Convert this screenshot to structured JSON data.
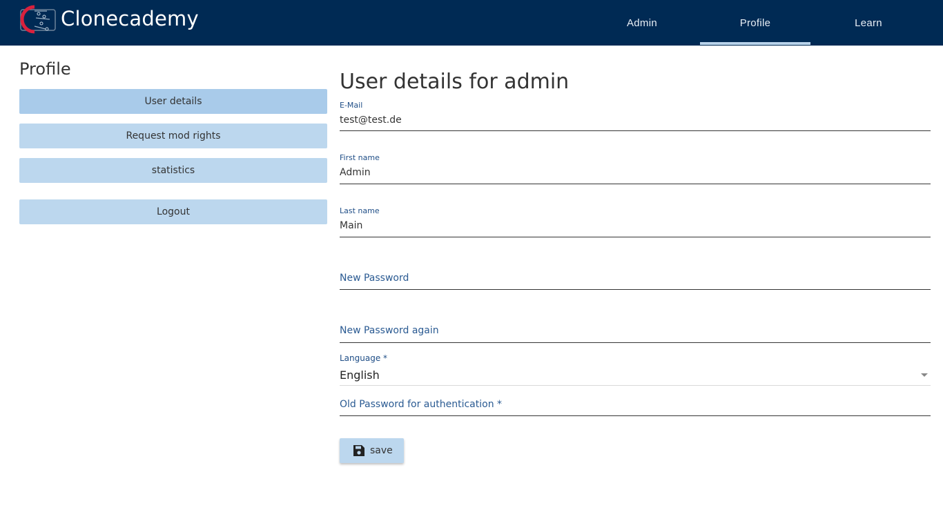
{
  "header": {
    "brand": "Clonecademy",
    "nav": [
      {
        "label": "Admin",
        "active": false
      },
      {
        "label": "Profile",
        "active": true
      },
      {
        "label": "Learn",
        "active": false
      }
    ]
  },
  "sidebar": {
    "title": "Profile",
    "items": [
      {
        "label": "User details",
        "active": true
      },
      {
        "label": "Request mod rights",
        "active": false
      },
      {
        "label": "statistics",
        "active": false
      },
      {
        "label": "Logout",
        "active": false
      }
    ]
  },
  "main": {
    "title": "User details for admin",
    "email": {
      "label": "E-Mail",
      "value": "test@test.de"
    },
    "first_name": {
      "label": "First name",
      "value": "Admin"
    },
    "last_name": {
      "label": "Last name",
      "value": "Main"
    },
    "new_password": {
      "placeholder": "New Password"
    },
    "new_password_again": {
      "placeholder": "New Password again"
    },
    "language": {
      "label": "Language *",
      "value": "English"
    },
    "old_password": {
      "placeholder": "Old Password for authentication *"
    },
    "save_label": "save"
  },
  "colors": {
    "header_bg": "#002a54",
    "button_bg": "#bcd7ee",
    "nav_active_underline": "#b9d3ea",
    "label_blue": "#1e4d86",
    "logo_red": "#d9213d"
  },
  "icons": {
    "logo": "clonecademy-logo-icon",
    "save": "floppy-disk-icon",
    "select_caret": "caret-down-icon"
  }
}
